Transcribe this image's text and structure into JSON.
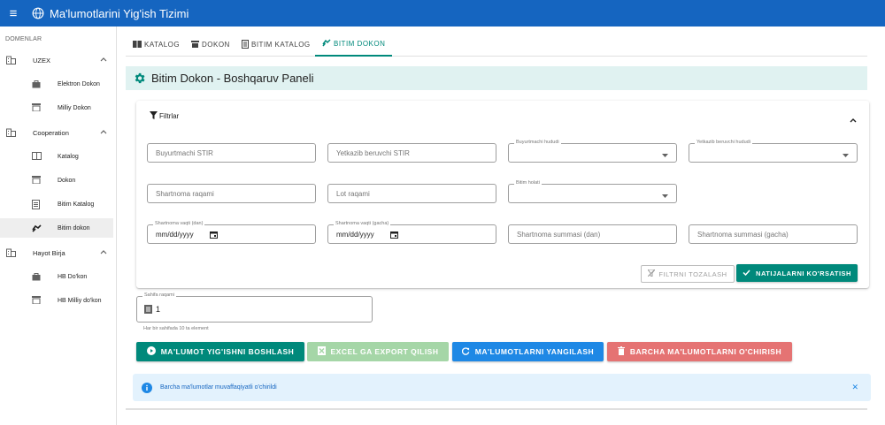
{
  "app": {
    "title": "Ma'lumotlarini Yig'ish Tizimi"
  },
  "sidebar": {
    "subheader": "DOMENLAR",
    "groups": [
      {
        "label": "UZEX",
        "items": [
          "Elektron Dokon",
          "Milliy Dokon"
        ]
      },
      {
        "label": "Cooperation",
        "items": [
          "Katalog",
          "Dokon",
          "Bitim Katalog",
          "Bitim dokon"
        ]
      },
      {
        "label": "Hayot Birja",
        "items": [
          "HB Do'kon",
          "HB Milliy do'kon"
        ]
      }
    ],
    "active_item": "Bitim dokon"
  },
  "tabs": [
    {
      "label": "KATALOG",
      "icon": "catalog-icon"
    },
    {
      "label": "DOKON",
      "icon": "store-icon"
    },
    {
      "label": "BITIM KATALOG",
      "icon": "document-icon"
    },
    {
      "label": "BITIM DOKON",
      "icon": "handshake-icon",
      "active": true
    }
  ],
  "panel": {
    "title": "Bitim Dokon - Boshqaruv Paneli",
    "icon": "gear-icon"
  },
  "filters": {
    "title": "Filtrlar",
    "buyer_stir": {
      "placeholder": "Buyurtmachi STIR"
    },
    "supplier_stir": {
      "placeholder": "Yetkazib beruvchi STIR"
    },
    "buyer_region": {
      "label": "Buyurtmachi hududi"
    },
    "supplier_region": {
      "label": "Yetkazib beruvchi hududi"
    },
    "contract_number": {
      "placeholder": "Shartnoma raqami"
    },
    "lot_number": {
      "placeholder": "Lot raqami"
    },
    "deal_status": {
      "label": "Bitim holati"
    },
    "date_from": {
      "label": "Shartnoma vaqti (dan)",
      "value": "mm/dd/yyyy"
    },
    "date_to": {
      "label": "Shartnoma vaqti (gacha)",
      "value": "mm/dd/yyyy"
    },
    "sum_from": {
      "placeholder": "Shartnoma summasi (dan)"
    },
    "sum_to": {
      "placeholder": "Shartnoma summasi (gacha)"
    },
    "clear_label": "FILTRNI TOZALASH",
    "show_label": "NATIJALARNI KO'RSATISH"
  },
  "pagination": {
    "label": "Sahifa raqami",
    "value": "1",
    "hint": "Har bir sahifada 10 ta element"
  },
  "actions": {
    "start": "MA'LUMOT YIG'ISHNI BOSHLASH",
    "export": "EXCEL GA EXPORT QILISH",
    "refresh": "MA'LUMOTLARNI YANGILASH",
    "delete": "BARCHA MA'LUMOTLARNI O'CHIRISH"
  },
  "colors": {
    "primary": "#1565c0",
    "teal": "#00897b",
    "export": "#a5d6a7",
    "refresh": "#1e88e5",
    "delete": "#e57373"
  },
  "alert": {
    "message": "Barcha ma'lumotlar muvaffaqiyatli o'chirildi"
  }
}
